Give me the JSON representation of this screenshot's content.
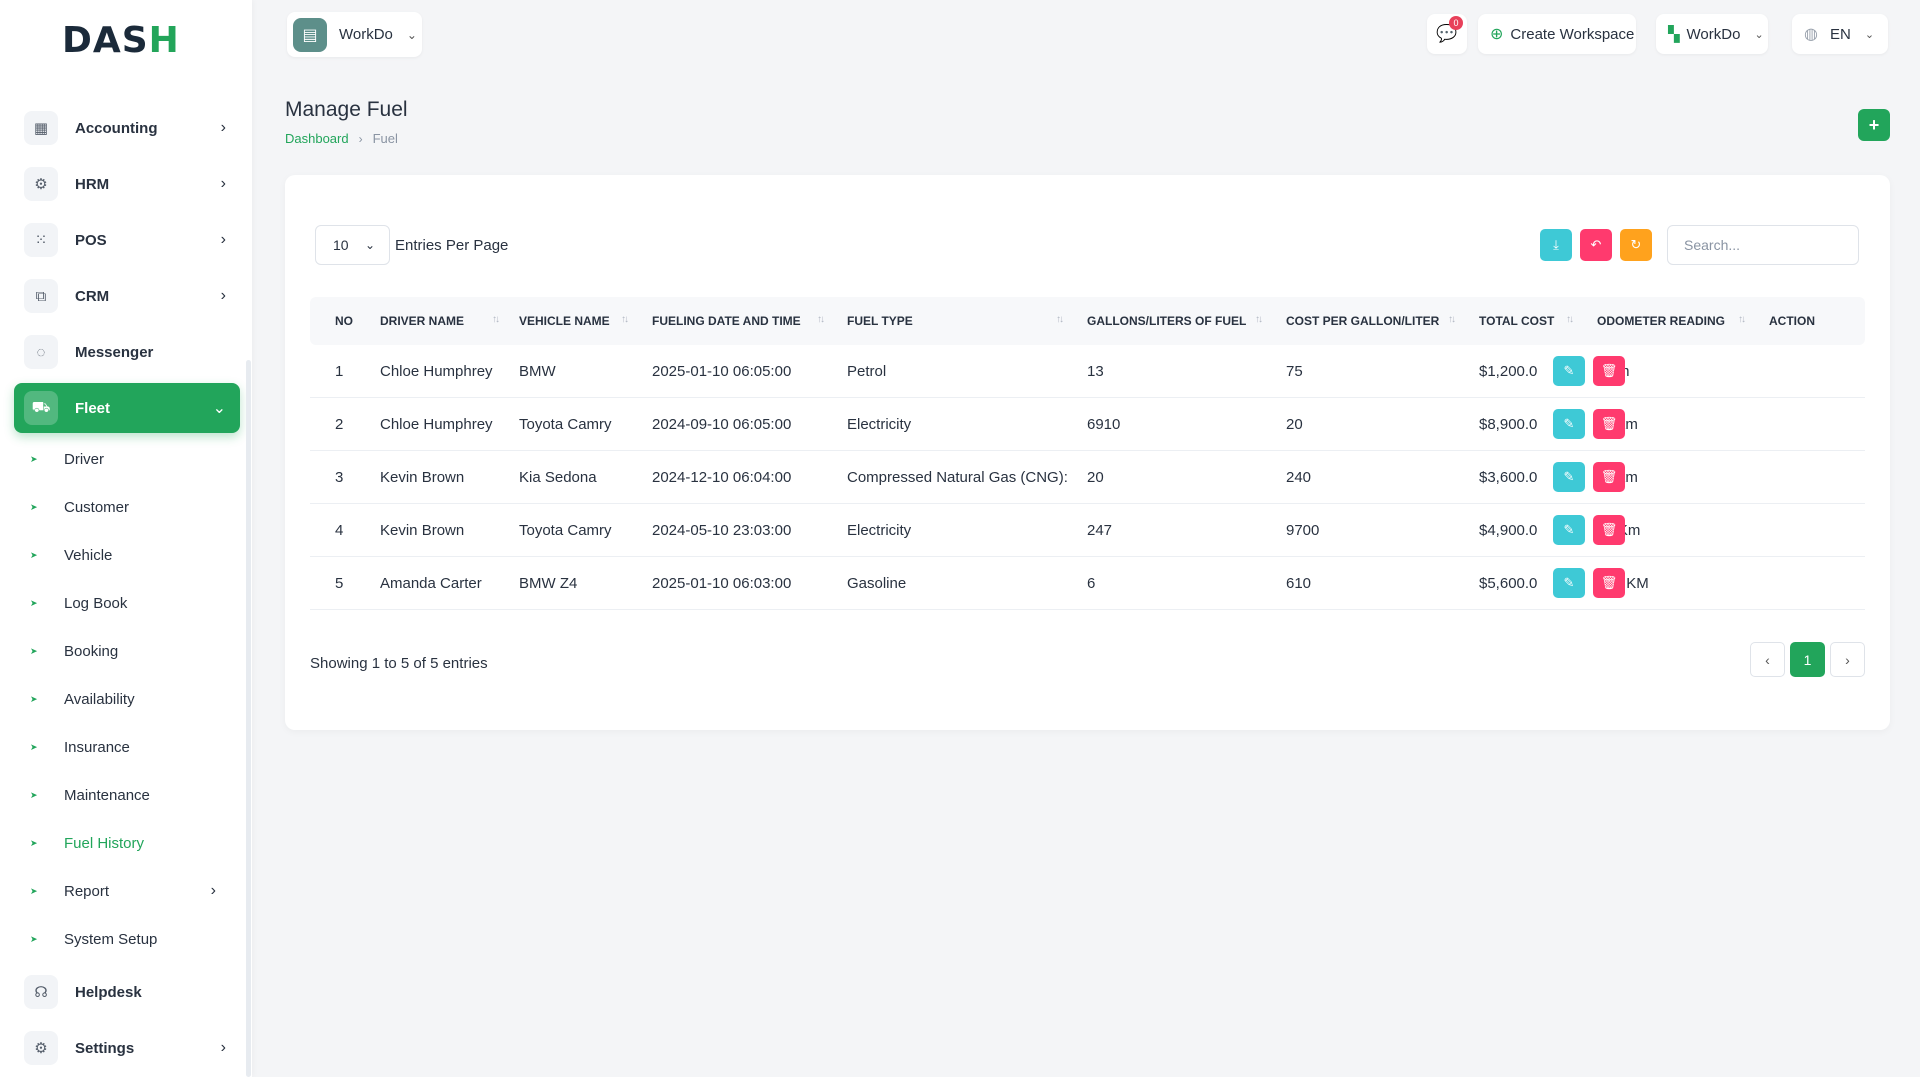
{
  "brand": {
    "name": "DASH"
  },
  "workspace": {
    "name": "WorkDo"
  },
  "header": {
    "messages_count": "0",
    "create_workspace_label": "Create Workspace",
    "workspace_switch_label": "WorkDo",
    "language": "EN"
  },
  "sidebar": {
    "items": [
      {
        "label": "Accounting",
        "icon": "grid-icon"
      },
      {
        "label": "HRM",
        "icon": "hrm-icon"
      },
      {
        "label": "POS",
        "icon": "dots-grid-icon"
      },
      {
        "label": "CRM",
        "icon": "crm-icon"
      },
      {
        "label": "Messenger",
        "icon": "chat-icon"
      },
      {
        "label": "Fleet",
        "icon": "car-icon"
      }
    ],
    "fleet_sub": [
      "Driver",
      "Customer",
      "Vehicle",
      "Log Book",
      "Booking",
      "Availability",
      "Insurance",
      "Maintenance",
      "Fuel History",
      "Report",
      "System Setup"
    ],
    "bottom_items": [
      {
        "label": "Helpdesk",
        "icon": "headset-icon"
      },
      {
        "label": "Settings",
        "icon": "gear-icon"
      }
    ]
  },
  "page": {
    "title": "Manage Fuel",
    "breadcrumb_home": "Dashboard",
    "breadcrumb_current": "Fuel"
  },
  "table_controls": {
    "per_page_value": "10",
    "per_page_label": "Entries Per Page",
    "search_placeholder": "Search..."
  },
  "table": {
    "headers": [
      "NO",
      "DRIVER NAME",
      "VEHICLE NAME",
      "FUELING DATE AND TIME",
      "FUEL TYPE",
      "GALLONS/LITERS OF FUEL",
      "COST PER GALLON/LITER",
      "TOTAL COST",
      "ODOMETER READING",
      "ACTION"
    ],
    "rows": [
      [
        "1",
        "Chloe Humphrey",
        "BMW",
        "2025-01-10 06:05:00",
        "Petrol",
        "13",
        "75",
        "$1,200.0",
        "5 km"
      ],
      [
        "2",
        "Chloe Humphrey",
        "Toyota Camry",
        "2024-09-10 06:05:00",
        "Electricity",
        "6910",
        "20",
        "$8,900.0",
        "10 km"
      ],
      [
        "3",
        "Kevin Brown",
        "Kia Sedona",
        "2024-12-10 06:04:00",
        "Compressed Natural Gas (CNG):",
        "20",
        "240",
        "$3,600.0",
        "15 km"
      ],
      [
        "4",
        "Kevin Brown",
        "Toyota Camry",
        "2024-05-10 23:03:00",
        "Electricity",
        "247",
        "9700",
        "$4,900.0",
        "10 Km"
      ],
      [
        "5",
        "Amanda Carter",
        "BMW Z4",
        "2025-01-10 06:03:00",
        "Gasoline",
        "6",
        "610",
        "$5,600.0",
        "150 KM"
      ]
    ]
  },
  "footer": {
    "showing": "Showing 1 to 5 of 5 entries",
    "current_page": "1"
  },
  "colors": {
    "accent": "#22a55b",
    "info": "#3ec9d6",
    "danger": "#ff3a6e",
    "warning": "#ffa21d"
  }
}
